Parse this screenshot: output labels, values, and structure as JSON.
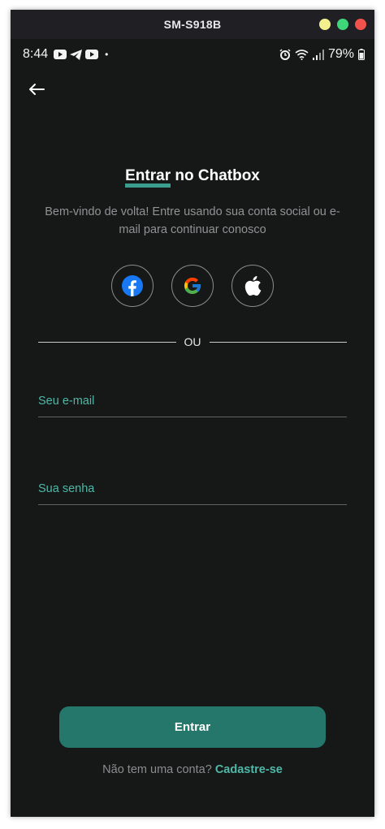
{
  "window": {
    "title": "SM-S918B",
    "controls": [
      {
        "name": "minimize",
        "color": "#f4f08e"
      },
      {
        "name": "maximize",
        "color": "#3fd67a"
      },
      {
        "name": "close",
        "color": "#f2524c"
      }
    ]
  },
  "statusbar": {
    "time": "8:44",
    "dot": "•",
    "left_icons": [
      "youtube-icon",
      "telegram-icon",
      "youtube-icon"
    ],
    "right_icons": [
      "alarm-icon",
      "wifi-icon",
      "signal-icon"
    ],
    "battery": "79%"
  },
  "header": {
    "back_icon": "back-arrow-icon"
  },
  "login": {
    "title_accent": "Entrar",
    "title_rest": " no Chatbox",
    "subtitle": "Bem-vindo de volta! Entre usando sua conta social ou e-mail para continuar conosco",
    "social": [
      "facebook",
      "google",
      "apple"
    ],
    "divider_label": "OU",
    "email_placeholder": "Seu e-mail",
    "password_placeholder": "Sua senha",
    "submit_label": "Entrar",
    "signup_question": "Não tem uma conta?",
    "signup_link": "Cadastre-se"
  },
  "colors": {
    "background": "#161818",
    "accent": "#3a9d8d",
    "button": "#24776a",
    "link": "#4fb8a6"
  }
}
